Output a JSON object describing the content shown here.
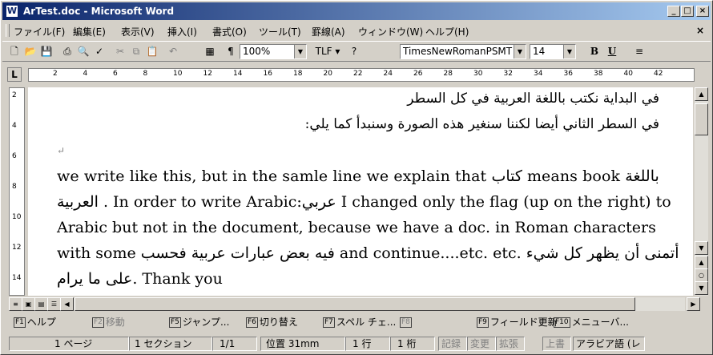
{
  "window": {
    "title": "ArTest.doc - Microsoft Word",
    "icon_letter": "W"
  },
  "title_buttons": {
    "minimize": "_",
    "maximize": "□",
    "close": "×"
  },
  "menu": {
    "items": [
      "ファイル(F)",
      "編集(E)",
      "表示(V)",
      "挿入(I)",
      "書式(O)",
      "ツール(T)",
      "罫線(A)",
      "ウィンドウ(W)",
      "ヘルプ(H)"
    ],
    "close": "×"
  },
  "toolbar": {
    "zoom": "100%",
    "direction": "TLF",
    "font_name": "TimesNewRomanPSMT",
    "font_size": "14",
    "bold": "B",
    "underline": "U"
  },
  "ruler": {
    "corner": "L",
    "ticks": [
      "2",
      "4",
      "6",
      "8",
      "10",
      "12",
      "14",
      "16",
      "18",
      "20",
      "22",
      "24",
      "26",
      "28",
      "30",
      "32",
      "34",
      "36",
      "38",
      "40",
      "42"
    ],
    "vticks": [
      "2",
      "4",
      "6",
      "8",
      "10",
      "12",
      "14"
    ]
  },
  "document": {
    "line1": "في البداية نكتب باللغة العربية في كل السطر",
    "line2": "في السطر الثاني أيضا لكننا سنغير هذه الصورة وسنبدأ كما يلي:",
    "line4": "we write like this, but in the samle line we explain that كتاب means book باللغة",
    "line5": "العربية . In order to write Arabic:عربي I changed only the flag (up on the right) to",
    "line6": "Arabic but not in the document, because we have a doc. in Roman characters",
    "line7": "with some فيه بعض عبارات عربية فحسب and continue....etc. etc. أتمنى أن يظهر كل شيء",
    "line8": "على ما يرام. Thank you"
  },
  "fkeys": [
    {
      "num": "F1",
      "label": "ヘルプ",
      "disabled": false
    },
    {
      "num": "F2",
      "label": "移動",
      "disabled": true
    },
    {
      "num": "F5",
      "label": "ジャンプ...",
      "disabled": false
    },
    {
      "num": "F6",
      "label": "切り替え",
      "disabled": false
    },
    {
      "num": "F7",
      "label": "スペル チェ...",
      "disabled": false
    },
    {
      "num": "F8",
      "label": "",
      "disabled": true
    },
    {
      "num": "F9",
      "label": "フィールド更新",
      "disabled": false
    },
    {
      "num": "F10",
      "label": "メニューバ...",
      "disabled": false
    }
  ],
  "status": {
    "page": "1 ページ",
    "section": "1 セクション",
    "pages": "1/1",
    "position": "位置 31mm",
    "line": "1 行",
    "column": "1 桁",
    "rec": "記録",
    "trk": "変更",
    "ext": "拡張",
    "ovr": "上書",
    "lang": "アラビア語 (レ"
  }
}
